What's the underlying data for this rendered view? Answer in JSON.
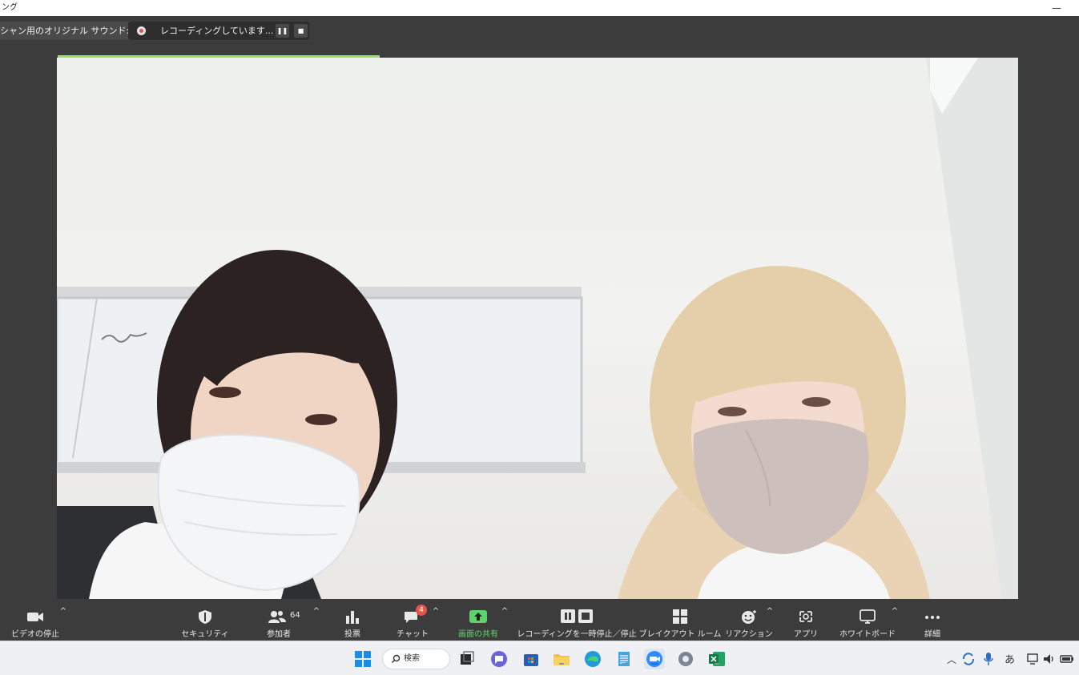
{
  "window": {
    "title": "ング",
    "minimize_glyph": "—"
  },
  "top_strip": {
    "sound_label": "シャン用のオリジナル サウンド: オフ",
    "recording_label": "レコーディングしています...",
    "pause_glyph": "❚❚",
    "stop_glyph": "■"
  },
  "toolbar": {
    "video": {
      "label": "ビデオの停止",
      "icon": "video-camera-icon"
    },
    "security": {
      "label": "セキュリティ",
      "icon": "shield-icon"
    },
    "participants": {
      "label": "参加者",
      "count": "64",
      "icon": "people-icon"
    },
    "polls": {
      "label": "投票",
      "icon": "bar-chart-icon"
    },
    "chat": {
      "label": "チャット",
      "badge": "4",
      "icon": "chat-bubble-icon"
    },
    "share": {
      "label": "画面の共有",
      "icon": "share-screen-icon",
      "color": "#5fd36b"
    },
    "recording": {
      "label": "レコーディングを一時停止／停止",
      "icon": "pause-stop-icon"
    },
    "breakout": {
      "label": "ブレイクアウト ルーム",
      "icon": "grid-icon"
    },
    "reactions": {
      "label": "リアクション",
      "icon": "smiley-icon"
    },
    "apps": {
      "label": "アプリ",
      "icon": "apps-icon"
    },
    "whiteboard": {
      "label": "ホワイトボード",
      "icon": "whiteboard-icon"
    },
    "more": {
      "label": "詳細",
      "icon": "ellipsis-icon"
    },
    "caret": "^"
  },
  "taskbar": {
    "search_label": "検索",
    "ime_label": "あ"
  },
  "colors": {
    "toolbar_bg": "#3c3c3c",
    "active_speaker": "#9be05a",
    "badge_red": "#e5534b"
  }
}
